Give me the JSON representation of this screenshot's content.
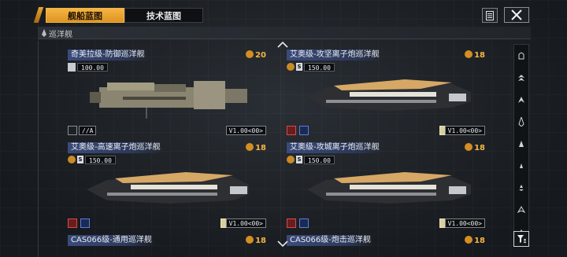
{
  "tabs": {
    "ship_blueprint": "舰船蓝图",
    "tech_blueprint": "技术蓝图"
  },
  "category": {
    "label": "巡洋舰"
  },
  "cards": [
    {
      "name": "奇美拉级-防御巡洋舰",
      "cost": "20",
      "price": "100.00",
      "tag_left": "//A",
      "version": "V1.00<00>"
    },
    {
      "name": "艾奥级-攻坚离子炮巡洋舰",
      "cost": "18",
      "price": "150.00",
      "version": "V1.00<00>"
    },
    {
      "name": "艾奥级-高速离子炮巡洋舰",
      "cost": "18",
      "price": "150.00",
      "version": "V1.00<00>"
    },
    {
      "name": "艾奥级-攻城离子炮巡洋舰",
      "cost": "18",
      "price": "150.00",
      "version": "V1.00<00>"
    },
    {
      "name": "CAS066级-通用巡洋舰",
      "cost": "18",
      "price": ""
    },
    {
      "name": "CAS066级-炮击巡洋舰",
      "cost": "18",
      "price": ""
    }
  ],
  "icons": {
    "close": "close-icon",
    "list": "list-icon",
    "filter": "filter-icon"
  },
  "colors": {
    "accent": "#f4b544",
    "name_bg": "#3a4b7a"
  }
}
